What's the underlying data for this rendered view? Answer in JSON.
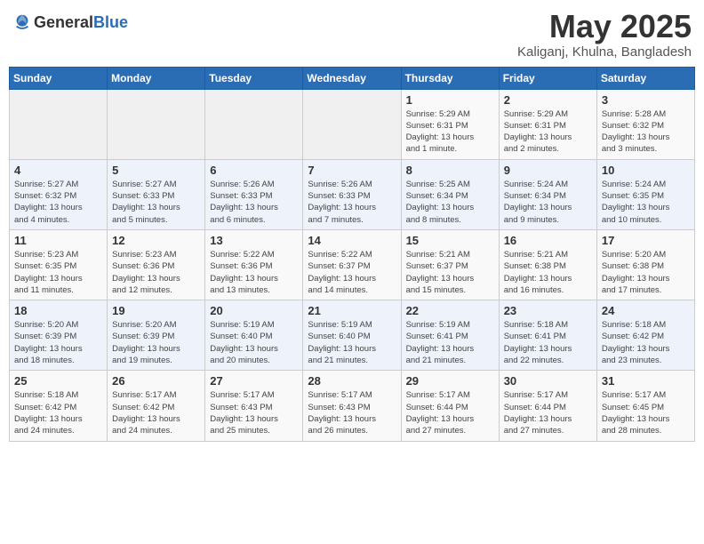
{
  "header": {
    "logo_general": "General",
    "logo_blue": "Blue",
    "month_title": "May 2025",
    "location": "Kaliganj, Khulna, Bangladesh"
  },
  "weekdays": [
    "Sunday",
    "Monday",
    "Tuesday",
    "Wednesday",
    "Thursday",
    "Friday",
    "Saturday"
  ],
  "weeks": [
    [
      {
        "day": "",
        "info": ""
      },
      {
        "day": "",
        "info": ""
      },
      {
        "day": "",
        "info": ""
      },
      {
        "day": "",
        "info": ""
      },
      {
        "day": "1",
        "info": "Sunrise: 5:29 AM\nSunset: 6:31 PM\nDaylight: 13 hours\nand 1 minute."
      },
      {
        "day": "2",
        "info": "Sunrise: 5:29 AM\nSunset: 6:31 PM\nDaylight: 13 hours\nand 2 minutes."
      },
      {
        "day": "3",
        "info": "Sunrise: 5:28 AM\nSunset: 6:32 PM\nDaylight: 13 hours\nand 3 minutes."
      }
    ],
    [
      {
        "day": "4",
        "info": "Sunrise: 5:27 AM\nSunset: 6:32 PM\nDaylight: 13 hours\nand 4 minutes."
      },
      {
        "day": "5",
        "info": "Sunrise: 5:27 AM\nSunset: 6:33 PM\nDaylight: 13 hours\nand 5 minutes."
      },
      {
        "day": "6",
        "info": "Sunrise: 5:26 AM\nSunset: 6:33 PM\nDaylight: 13 hours\nand 6 minutes."
      },
      {
        "day": "7",
        "info": "Sunrise: 5:26 AM\nSunset: 6:33 PM\nDaylight: 13 hours\nand 7 minutes."
      },
      {
        "day": "8",
        "info": "Sunrise: 5:25 AM\nSunset: 6:34 PM\nDaylight: 13 hours\nand 8 minutes."
      },
      {
        "day": "9",
        "info": "Sunrise: 5:24 AM\nSunset: 6:34 PM\nDaylight: 13 hours\nand 9 minutes."
      },
      {
        "day": "10",
        "info": "Sunrise: 5:24 AM\nSunset: 6:35 PM\nDaylight: 13 hours\nand 10 minutes."
      }
    ],
    [
      {
        "day": "11",
        "info": "Sunrise: 5:23 AM\nSunset: 6:35 PM\nDaylight: 13 hours\nand 11 minutes."
      },
      {
        "day": "12",
        "info": "Sunrise: 5:23 AM\nSunset: 6:36 PM\nDaylight: 13 hours\nand 12 minutes."
      },
      {
        "day": "13",
        "info": "Sunrise: 5:22 AM\nSunset: 6:36 PM\nDaylight: 13 hours\nand 13 minutes."
      },
      {
        "day": "14",
        "info": "Sunrise: 5:22 AM\nSunset: 6:37 PM\nDaylight: 13 hours\nand 14 minutes."
      },
      {
        "day": "15",
        "info": "Sunrise: 5:21 AM\nSunset: 6:37 PM\nDaylight: 13 hours\nand 15 minutes."
      },
      {
        "day": "16",
        "info": "Sunrise: 5:21 AM\nSunset: 6:38 PM\nDaylight: 13 hours\nand 16 minutes."
      },
      {
        "day": "17",
        "info": "Sunrise: 5:20 AM\nSunset: 6:38 PM\nDaylight: 13 hours\nand 17 minutes."
      }
    ],
    [
      {
        "day": "18",
        "info": "Sunrise: 5:20 AM\nSunset: 6:39 PM\nDaylight: 13 hours\nand 18 minutes."
      },
      {
        "day": "19",
        "info": "Sunrise: 5:20 AM\nSunset: 6:39 PM\nDaylight: 13 hours\nand 19 minutes."
      },
      {
        "day": "20",
        "info": "Sunrise: 5:19 AM\nSunset: 6:40 PM\nDaylight: 13 hours\nand 20 minutes."
      },
      {
        "day": "21",
        "info": "Sunrise: 5:19 AM\nSunset: 6:40 PM\nDaylight: 13 hours\nand 21 minutes."
      },
      {
        "day": "22",
        "info": "Sunrise: 5:19 AM\nSunset: 6:41 PM\nDaylight: 13 hours\nand 21 minutes."
      },
      {
        "day": "23",
        "info": "Sunrise: 5:18 AM\nSunset: 6:41 PM\nDaylight: 13 hours\nand 22 minutes."
      },
      {
        "day": "24",
        "info": "Sunrise: 5:18 AM\nSunset: 6:42 PM\nDaylight: 13 hours\nand 23 minutes."
      }
    ],
    [
      {
        "day": "25",
        "info": "Sunrise: 5:18 AM\nSunset: 6:42 PM\nDaylight: 13 hours\nand 24 minutes."
      },
      {
        "day": "26",
        "info": "Sunrise: 5:17 AM\nSunset: 6:42 PM\nDaylight: 13 hours\nand 24 minutes."
      },
      {
        "day": "27",
        "info": "Sunrise: 5:17 AM\nSunset: 6:43 PM\nDaylight: 13 hours\nand 25 minutes."
      },
      {
        "day": "28",
        "info": "Sunrise: 5:17 AM\nSunset: 6:43 PM\nDaylight: 13 hours\nand 26 minutes."
      },
      {
        "day": "29",
        "info": "Sunrise: 5:17 AM\nSunset: 6:44 PM\nDaylight: 13 hours\nand 27 minutes."
      },
      {
        "day": "30",
        "info": "Sunrise: 5:17 AM\nSunset: 6:44 PM\nDaylight: 13 hours\nand 27 minutes."
      },
      {
        "day": "31",
        "info": "Sunrise: 5:17 AM\nSunset: 6:45 PM\nDaylight: 13 hours\nand 28 minutes."
      }
    ]
  ]
}
